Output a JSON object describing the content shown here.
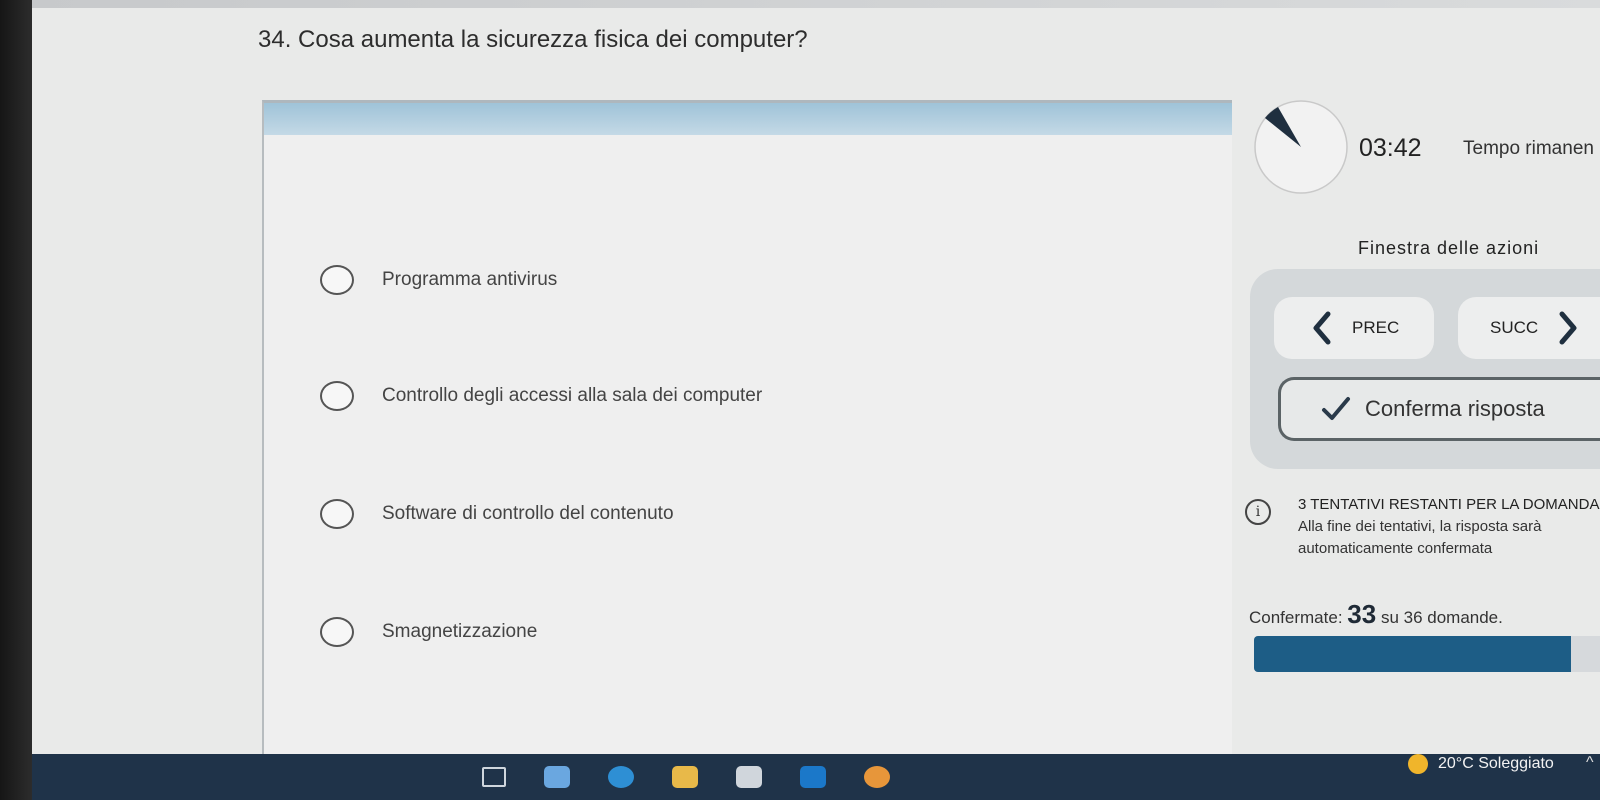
{
  "question": {
    "number": "34.",
    "text": "Cosa aumenta la sicurezza fisica dei computer?"
  },
  "options": [
    {
      "label": "Programma antivirus"
    },
    {
      "label": "Controllo degli accessi alla sala dei computer"
    },
    {
      "label": "Software di controllo del contenuto"
    },
    {
      "label": "Smagnetizzazione"
    }
  ],
  "timer": {
    "value": "03:42",
    "label": "Tempo rimanen"
  },
  "actions": {
    "title": "Finestra delle azioni",
    "prev_label": "PREC",
    "next_label": "SUCC",
    "confirm_label": "Conferma risposta"
  },
  "attempts": {
    "title": "3 TENTATIVI RESTANTI PER LA DOMANDA",
    "description": "Alla fine dei tentativi, la risposta sarà automaticamente confermata"
  },
  "progress": {
    "prefix": "Confermate:",
    "confirmed": "33",
    "suffix": "su 36 domande.",
    "fraction": 0.917
  },
  "taskbar": {
    "weather": "20°C Soleggiato",
    "icons": [
      "task-view-icon",
      "app-icon",
      "edge-icon",
      "file-explorer-icon",
      "store-icon",
      "outlook-icon",
      "app-icon-orange"
    ]
  },
  "colors": {
    "accent": "#1d5d86",
    "taskbar": "#1f3349"
  }
}
